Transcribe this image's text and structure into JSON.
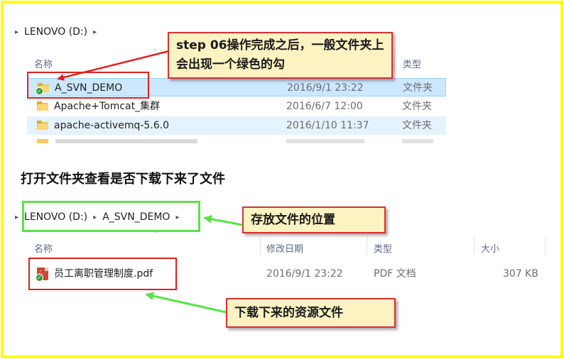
{
  "top_window": {
    "breadcrumb": [
      "LENOVO (D:)"
    ],
    "columns": {
      "name": "名称",
      "type": "类型"
    },
    "rows": [
      {
        "name": "A_SVN_DEMO",
        "date": "2016/9/1 23:22",
        "type": "文件夹",
        "svn_status": "normal"
      },
      {
        "name": "Apache+Tomcat_集群",
        "date": "2016/6/7 12:00",
        "type": "文件夹"
      },
      {
        "name": "apache-activemq-5.6.0",
        "date": "2016/1/10 11:37",
        "type": "文件夹"
      }
    ]
  },
  "callout_step": {
    "prefix": "step 06",
    "text": "操作完成之后，一般文件夹上会出现一个绿色的勾"
  },
  "heading": "打开文件夹查看是否下载下来了文件",
  "bottom_window": {
    "breadcrumb": [
      "LENOVO (D:)",
      "A_SVN_DEMO"
    ],
    "columns": {
      "name": "名称",
      "date": "修改日期",
      "type": "类型",
      "size": "大小"
    },
    "rows": [
      {
        "name": "员工离职管理制度.pdf",
        "date": "2016/9/1 23:22",
        "type": "PDF 文档",
        "size": "307 KB"
      }
    ]
  },
  "callout_location": "存放文件的位置",
  "callout_resource": "下载下来的资源文件",
  "colors": {
    "frame": "#ffff00",
    "callout_border": "#d83030",
    "callout_fill": "#fdf3c2",
    "green_arrow": "#5be24a",
    "red_box": "#e02020",
    "selection": "#cce8ff"
  }
}
